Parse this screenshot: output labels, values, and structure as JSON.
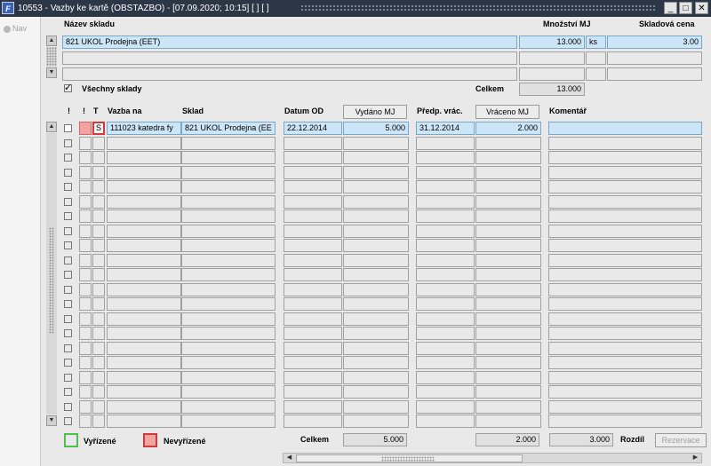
{
  "window": {
    "app_icon": "F",
    "title": "10553 - Vazby ke kartě (OBSTAZBO) - [07.09.2020; 10:15]  [ ]  [ ]",
    "min_label": "_",
    "max_label": "□",
    "close_label": "✕"
  },
  "sidebar": {
    "nav_label": "Nav"
  },
  "warehouse": {
    "headers": {
      "name": "Název skladu",
      "qty": "Množství MJ",
      "price": "Skladová cena"
    },
    "rows": [
      {
        "name": "821 UKOL Prodejna (EET)",
        "qty": "13.000",
        "unit": "ks",
        "price": "3.00"
      },
      {
        "name": "",
        "qty": "",
        "unit": "",
        "price": ""
      },
      {
        "name": "",
        "qty": "",
        "unit": "",
        "price": ""
      }
    ],
    "all_label": "Všechny sklady",
    "all_checked": true,
    "total_label": "Celkem",
    "total_value": "13.000"
  },
  "bindings": {
    "headers": {
      "bang1": "!",
      "bang2": "!",
      "t": "T",
      "vazba": "Vazba na",
      "sklad": "Sklad",
      "datum": "Datum OD",
      "vydano": "Vydáno MJ",
      "predp": "Předp. vrác.",
      "vraceno": "Vráceno MJ",
      "komentar": "Komentář"
    },
    "rows": [
      {
        "t": "S",
        "vazba": "111023 katedra fy",
        "sklad": "821 UKOL Prodejna (EE",
        "datum": "22.12.2014",
        "vydano": "5.000",
        "predp": "31.12.2014",
        "vraceno": "2.000",
        "komentar": ""
      }
    ],
    "empty_rows": 20
  },
  "legend": {
    "done": "Vyřízené",
    "pending": "Nevyřízené"
  },
  "footer": {
    "total_label": "Celkem",
    "vydano_total": "5.000",
    "vraceno_total": "2.000",
    "diff_value": "3.000",
    "diff_label": "Rozdíl",
    "reservation_button": "Rezervace"
  },
  "colors": {
    "titlebar": "#2b3647",
    "selection": "#cde6f7",
    "pending": "#f4a2a2",
    "done_border": "#4fbf4f"
  }
}
